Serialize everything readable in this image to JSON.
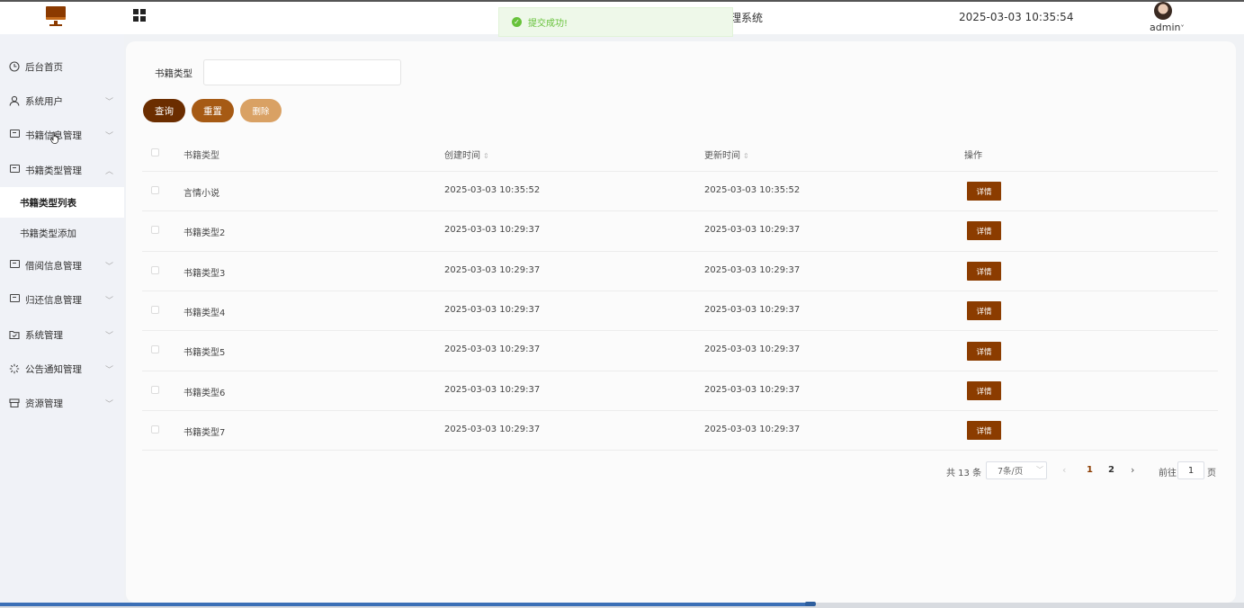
{
  "header": {
    "title_fragment": "理系统",
    "datetime": "2025-03-03 10:35:54",
    "user": "admin",
    "user_caret": "˅"
  },
  "toast": {
    "message": "提交成功!"
  },
  "sidebar": {
    "items": [
      {
        "label": "后台首页",
        "icon": "clock-icon"
      },
      {
        "label": "系统用户",
        "icon": "user-icon"
      },
      {
        "label": "书籍信息管理",
        "icon": "card-icon"
      },
      {
        "label": "书籍类型管理",
        "icon": "card-icon"
      },
      {
        "label": "借阅信息管理",
        "icon": "card-icon"
      },
      {
        "label": "归还信息管理",
        "icon": "card-icon"
      },
      {
        "label": "系统管理",
        "icon": "folder-icon"
      },
      {
        "label": "公告通知管理",
        "icon": "loading-icon"
      },
      {
        "label": "资源管理",
        "icon": "box-icon"
      }
    ],
    "sub_items": [
      {
        "label": "书籍类型列表",
        "active": true
      },
      {
        "label": "书籍类型添加",
        "active": false
      }
    ]
  },
  "filter": {
    "label": "书籍类型",
    "value": ""
  },
  "buttons": {
    "search": "查询",
    "reset": "重置",
    "delete": "删除"
  },
  "table": {
    "headers": {
      "type": "书籍类型",
      "created": "创建时间",
      "updated": "更新时间",
      "actions": "操作"
    },
    "rows": [
      {
        "type": "言情小说",
        "created": "2025-03-03 10:35:52",
        "updated": "2025-03-03 10:35:52",
        "action": "详情"
      },
      {
        "type": "书籍类型2",
        "created": "2025-03-03 10:29:37",
        "updated": "2025-03-03 10:29:37",
        "action": "详情"
      },
      {
        "type": "书籍类型3",
        "created": "2025-03-03 10:29:37",
        "updated": "2025-03-03 10:29:37",
        "action": "详情"
      },
      {
        "type": "书籍类型4",
        "created": "2025-03-03 10:29:37",
        "updated": "2025-03-03 10:29:37",
        "action": "详情"
      },
      {
        "type": "书籍类型5",
        "created": "2025-03-03 10:29:37",
        "updated": "2025-03-03 10:29:37",
        "action": "详情"
      },
      {
        "type": "书籍类型6",
        "created": "2025-03-03 10:29:37",
        "updated": "2025-03-03 10:29:37",
        "action": "详情"
      },
      {
        "type": "书籍类型7",
        "created": "2025-03-03 10:29:37",
        "updated": "2025-03-03 10:29:37",
        "action": "详情"
      }
    ]
  },
  "pagination": {
    "total": "共 13 条",
    "page_size": "7条/页",
    "pages": [
      "1",
      "2"
    ],
    "current": "1",
    "goto_label": "前往",
    "goto_value": "1",
    "page_suffix": "页"
  },
  "colors": {
    "accent": "#8b3c00",
    "search_button": "#6b2d00",
    "reset_button": "#a65a14",
    "delete_button": "#d9a164",
    "toast": "#67c23a"
  }
}
